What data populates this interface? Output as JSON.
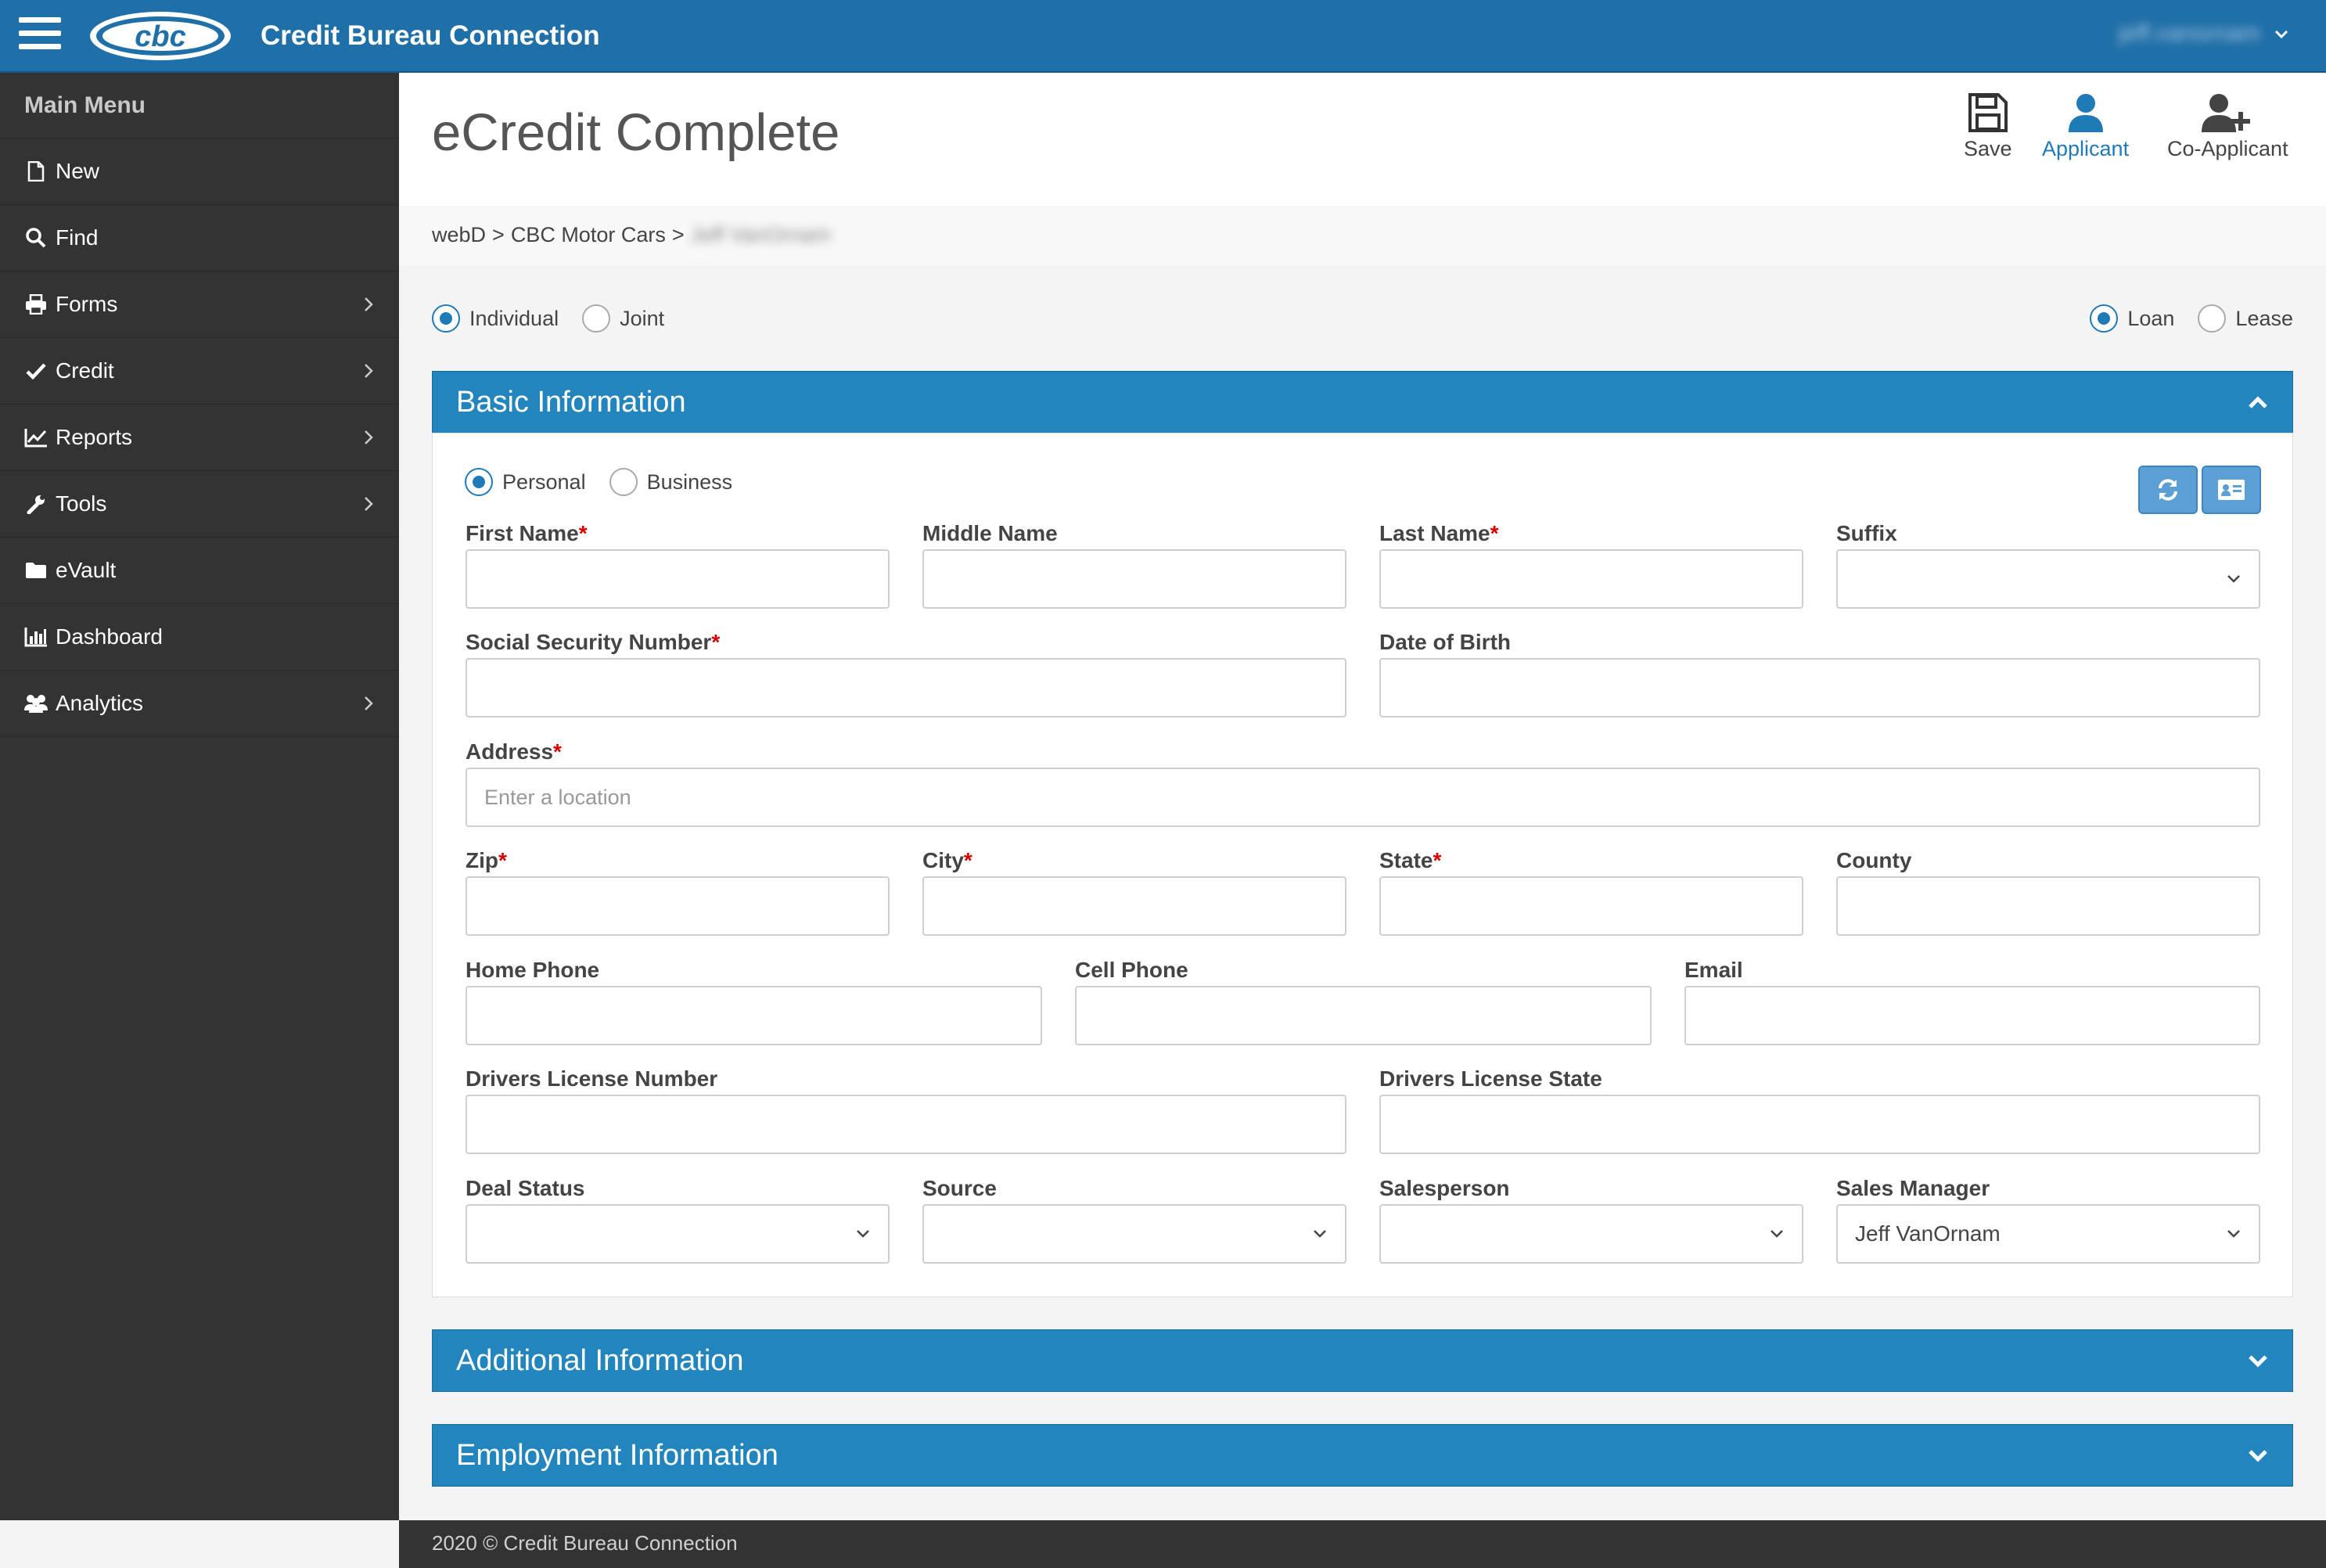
{
  "brand": {
    "logo_text": "cbc",
    "title": "Credit Bureau Connection"
  },
  "user": {
    "name": "jeff.vanornam"
  },
  "sidebar": {
    "header": "Main Menu",
    "items": [
      {
        "label": "New",
        "icon": "file-icon",
        "has_submenu": false
      },
      {
        "label": "Find",
        "icon": "search-icon",
        "has_submenu": false
      },
      {
        "label": "Forms",
        "icon": "print-icon",
        "has_submenu": true
      },
      {
        "label": "Credit",
        "icon": "check-icon",
        "has_submenu": true
      },
      {
        "label": "Reports",
        "icon": "line-chart-icon",
        "has_submenu": true
      },
      {
        "label": "Tools",
        "icon": "wrench-icon",
        "has_submenu": true
      },
      {
        "label": "eVault",
        "icon": "folder-icon",
        "has_submenu": false
      },
      {
        "label": "Dashboard",
        "icon": "bar-chart-icon",
        "has_submenu": false
      },
      {
        "label": "Analytics",
        "icon": "users-icon",
        "has_submenu": true
      }
    ]
  },
  "page": {
    "title": "eCredit Complete"
  },
  "toolbar": {
    "save_label": "Save",
    "applicant_label": "Applicant",
    "coapplicant_label": "Co-Applicant"
  },
  "breadcrumb": {
    "part1": "webD",
    "sep": ">",
    "part2": "CBC Motor Cars",
    "part3": "Jeff VanOrnam"
  },
  "application_type": {
    "options": [
      "Individual",
      "Joint"
    ],
    "selected": "Individual"
  },
  "product_type": {
    "options": [
      "Loan",
      "Lease"
    ],
    "selected": "Loan"
  },
  "panels": {
    "basic": {
      "title": "Basic Information",
      "expanded": true
    },
    "additional": {
      "title": "Additional Information",
      "expanded": false
    },
    "employment": {
      "title": "Employment Information",
      "expanded": false
    }
  },
  "entity_type": {
    "options": [
      "Personal",
      "Business"
    ],
    "selected": "Personal"
  },
  "form": {
    "first_name": {
      "label": "First Name",
      "required": "*",
      "value": ""
    },
    "middle_name": {
      "label": "Middle Name",
      "value": ""
    },
    "last_name": {
      "label": "Last Name",
      "required": "*",
      "value": ""
    },
    "suffix": {
      "label": "Suffix",
      "value": ""
    },
    "ssn": {
      "label": "Social Security Number",
      "required": "*",
      "value": ""
    },
    "dob": {
      "label": "Date of Birth",
      "value": ""
    },
    "address": {
      "label": "Address",
      "required": "*",
      "value": "",
      "placeholder": "Enter a location"
    },
    "zip": {
      "label": "Zip",
      "required": "*",
      "value": ""
    },
    "city": {
      "label": "City",
      "required": "*",
      "value": ""
    },
    "state": {
      "label": "State",
      "required": "*",
      "value": ""
    },
    "county": {
      "label": "County",
      "value": ""
    },
    "home_phone": {
      "label": "Home Phone",
      "value": ""
    },
    "cell_phone": {
      "label": "Cell Phone",
      "value": ""
    },
    "email": {
      "label": "Email",
      "value": ""
    },
    "dl_number": {
      "label": "Drivers License Number",
      "value": ""
    },
    "dl_state": {
      "label": "Drivers License State",
      "value": ""
    },
    "deal_status": {
      "label": "Deal Status",
      "value": ""
    },
    "source": {
      "label": "Source",
      "value": ""
    },
    "salesperson": {
      "label": "Salesperson",
      "value": ""
    },
    "sales_manager": {
      "label": "Sales Manager",
      "value": "Jeff VanOrnam"
    }
  },
  "footer": {
    "text": "2020 © Credit Bureau Connection"
  },
  "colors": {
    "topbar": "#1f6fa9",
    "panel_header": "#2385bd",
    "sidebar": "#333333",
    "accent": "#1f7ab8",
    "required": "#d60000"
  }
}
